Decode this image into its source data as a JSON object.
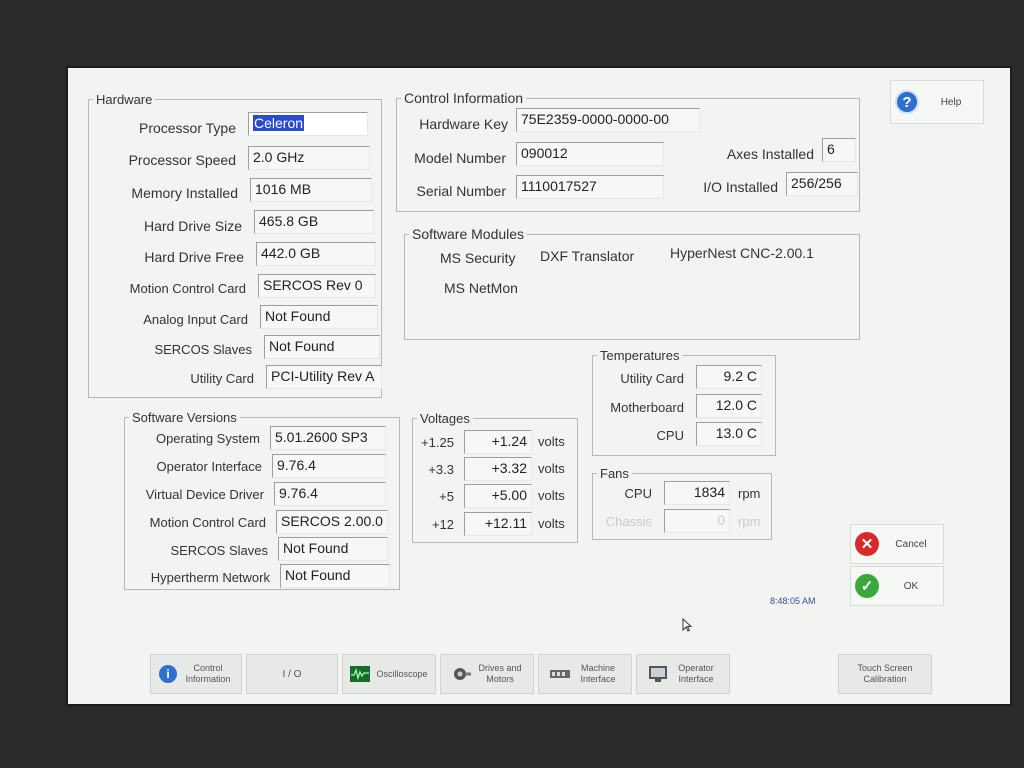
{
  "hardware": {
    "legend": "Hardware",
    "rows": [
      {
        "label": "Processor Type",
        "value": "Celeron"
      },
      {
        "label": "Processor Speed",
        "value": "2.0 GHz"
      },
      {
        "label": "Memory Installed",
        "value": "1016 MB"
      },
      {
        "label": "Hard Drive Size",
        "value": "465.8 GB"
      },
      {
        "label": "Hard Drive Free",
        "value": "442.0 GB"
      },
      {
        "label": "Motion Control Card",
        "value": "SERCOS Rev 0"
      },
      {
        "label": "Analog Input Card",
        "value": "Not Found"
      },
      {
        "label": "SERCOS Slaves",
        "value": "Not Found"
      },
      {
        "label": "Utility Card",
        "value": "PCI-Utility Rev A"
      }
    ]
  },
  "software_versions": {
    "legend": "Software Versions",
    "rows": [
      {
        "label": "Operating System",
        "value": "5.01.2600 SP3"
      },
      {
        "label": "Operator Interface",
        "value": "9.76.4"
      },
      {
        "label": "Virtual Device Driver",
        "value": "9.76.4"
      },
      {
        "label": "Motion Control Card",
        "value": "SERCOS 2.00.0"
      },
      {
        "label": "SERCOS Slaves",
        "value": "Not Found"
      },
      {
        "label": "Hypertherm Network",
        "value": "Not Found"
      }
    ]
  },
  "control_info": {
    "legend": "Control Information",
    "hardware_key_label": "Hardware Key",
    "hardware_key": "75E2359-0000-0000-00",
    "model_number_label": "Model Number",
    "model_number": "090012",
    "serial_number_label": "Serial Number",
    "serial_number": "1110017527",
    "axes_installed_label": "Axes Installed",
    "axes_installed": "6",
    "io_installed_label": "I/O Installed",
    "io_installed": "256/256"
  },
  "software_modules": {
    "legend": "Software Modules",
    "items": [
      "MS Security",
      "DXF Translator",
      "HyperNest CNC-2.00.1",
      "MS NetMon"
    ]
  },
  "voltages": {
    "legend": "Voltages",
    "unit": "volts",
    "rows": [
      {
        "label": "+1.25",
        "value": "+1.24"
      },
      {
        "label": "+3.3",
        "value": "+3.32"
      },
      {
        "label": "+5",
        "value": "+5.00"
      },
      {
        "label": "+12",
        "value": "+12.11"
      }
    ]
  },
  "temperatures": {
    "legend": "Temperatures",
    "rows": [
      {
        "label": "Utility Card",
        "value": "9.2 C"
      },
      {
        "label": "Motherboard",
        "value": "12.0 C"
      },
      {
        "label": "CPU",
        "value": "13.0 C"
      }
    ]
  },
  "fans": {
    "legend": "Fans",
    "unit": "rpm",
    "rows": [
      {
        "label": "CPU",
        "value": "1834"
      },
      {
        "label": "Chassis",
        "value": "0"
      }
    ]
  },
  "buttons": {
    "help": "Help",
    "cancel": "Cancel",
    "ok": "OK",
    "touch_calibration": "Touch Screen Calibration"
  },
  "clock": "8:48:05 AM",
  "tabs": [
    {
      "label": "Control Information",
      "icon": "info-icon"
    },
    {
      "label": "I / O",
      "icon": ""
    },
    {
      "label": "Oscilloscope",
      "icon": "oscilloscope-icon"
    },
    {
      "label": "Drives and Motors",
      "icon": "motor-icon"
    },
    {
      "label": "Machine Interface",
      "icon": "machine-interface-icon"
    },
    {
      "label": "Operator Interface",
      "icon": "monitor-icon"
    }
  ],
  "colors": {
    "selection": "#2a4bd0",
    "help_icon": "#2f6fd0",
    "cancel_icon": "#d82a2a",
    "ok_icon": "#3aa83a"
  }
}
